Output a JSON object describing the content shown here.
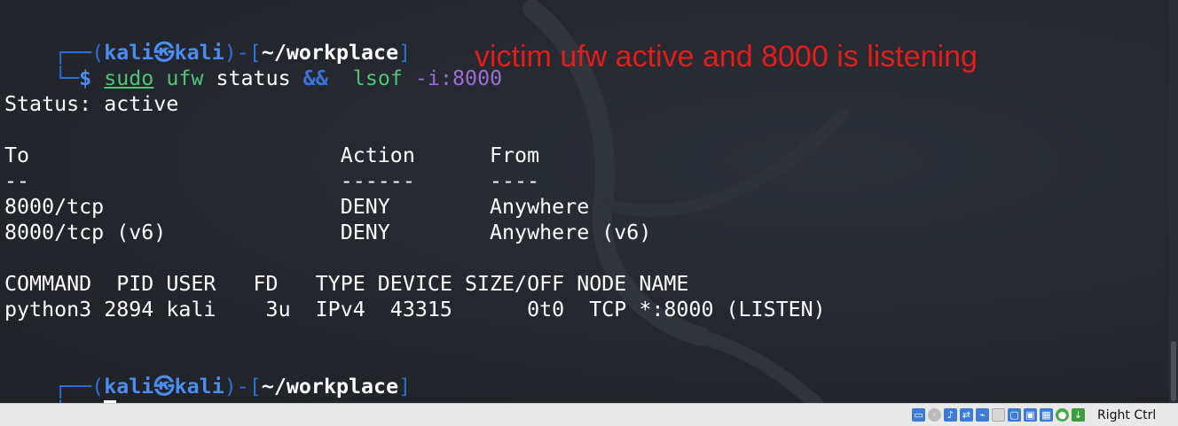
{
  "prompt": {
    "corner_top": "┌──(",
    "user": "kali",
    "at_symbol": "㉿",
    "host": "kali",
    "sep": ")-[",
    "cwd": "~/workplace",
    "close": "]",
    "corner_bottom": "└─",
    "dollar": "$"
  },
  "command": {
    "sudo": "sudo",
    "ufw": "ufw",
    "args1": " status ",
    "amp": "&&",
    "lsof": "lsof",
    "opt": "-i:8000"
  },
  "annotation": "victim ufw active and 8000 is listening",
  "output": [
    "Status: active",
    "",
    "To                         Action      From",
    "--                         ------      ----",
    "8000/tcp                   DENY        Anywhere",
    "8000/tcp (v6)              DENY        Anywhere (v6)",
    "",
    "COMMAND  PID USER   FD   TYPE DEVICE SIZE/OFF NODE NAME",
    "python3 2894 kali    3u  IPv4  43315      0t0  TCP *:8000 (LISTEN)"
  ],
  "statusbar": {
    "host_key": "Right Ctrl",
    "icons": [
      "hdd-icon",
      "optical-icon",
      "audio-icon",
      "network-icon",
      "usb-icon",
      "shared-folder-icon",
      "display-icon",
      "recording-icon",
      "cpu-icon",
      "mouse-integration-icon",
      "keyboard-icon"
    ]
  },
  "colors": {
    "background": "#24272e",
    "prompt_frame": "#2e6fd6",
    "annotation": "#e31c1c",
    "command": "#4fc37a"
  }
}
